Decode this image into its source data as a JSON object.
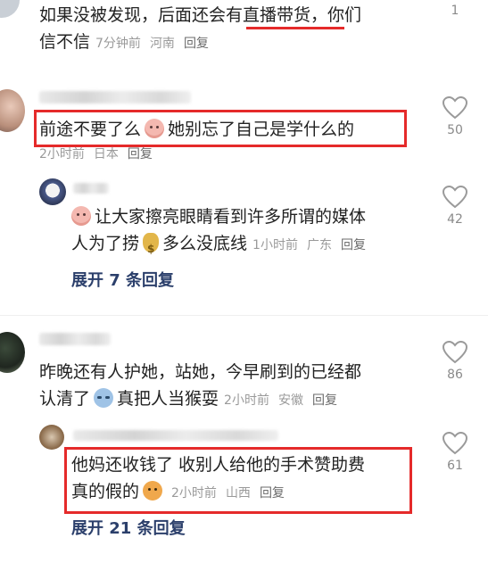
{
  "comments": [
    {
      "line1": "如果没被发现，后面还会有直播带货，你们",
      "line2": "信不信",
      "time": "7分钟前",
      "location": "河南",
      "reply": "回复",
      "likes": "1"
    },
    {
      "text_a": "前途不要了么",
      "text_b": "她别忘了自己是学什么的",
      "time": "2小时前",
      "location": "日本",
      "reply": "回复",
      "likes": "50",
      "sub": {
        "line1_a": "让大家擦亮眼睛看到许多所谓的媒体",
        "line2_a": "人为了捞",
        "line2_b": "多么没底线",
        "time": "1小时前",
        "location": "广东",
        "reply": "回复",
        "likes": "42"
      },
      "expand": "展开 7 条回复"
    },
    {
      "line1": "昨晚还有人护她，站她，今早刷到的已经都",
      "line2_a": "认清了",
      "line2_b": "真把人当猴耍",
      "time": "2小时前",
      "location": "安徽",
      "reply": "回复",
      "likes": "86",
      "sub": {
        "line1": "他妈还收钱了 收别人给他的手术赞助费",
        "line2": "真的假的",
        "time": "2小时前",
        "location": "山西",
        "reply": "回复",
        "likes": "61"
      },
      "expand": "展开 21 条回复"
    }
  ],
  "colors": {
    "highlight": "#e52a2a",
    "link": "#2b3f6b",
    "meta": "#9a9a9a"
  }
}
